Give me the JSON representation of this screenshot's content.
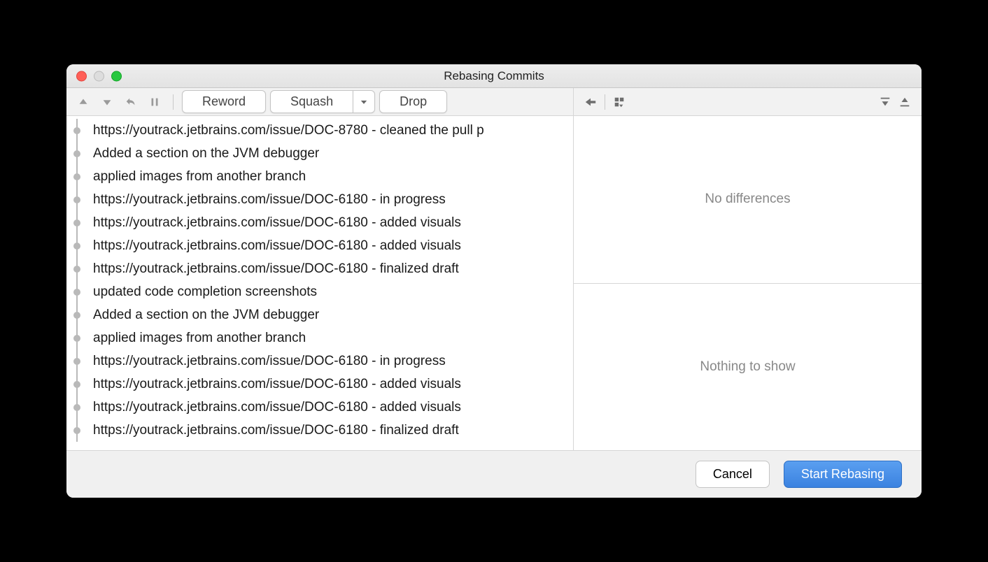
{
  "window": {
    "title": "Rebasing Commits"
  },
  "toolbar": {
    "reword": "Reword",
    "squash": "Squash",
    "drop": "Drop"
  },
  "commits": [
    {
      "msg": "https://youtrack.jetbrains.com/issue/DOC-8780 - cleaned the pull p"
    },
    {
      "msg": "Added a section on the JVM debugger"
    },
    {
      "msg": "applied images from another branch"
    },
    {
      "msg": "https://youtrack.jetbrains.com/issue/DOC-6180 - in progress"
    },
    {
      "msg": "https://youtrack.jetbrains.com/issue/DOC-6180 - added visuals"
    },
    {
      "msg": "https://youtrack.jetbrains.com/issue/DOC-6180 - added visuals"
    },
    {
      "msg": "https://youtrack.jetbrains.com/issue/DOC-6180 - finalized draft"
    },
    {
      "msg": "updated code completion screenshots"
    },
    {
      "msg": "Added a section on the JVM debugger"
    },
    {
      "msg": "applied images from another branch"
    },
    {
      "msg": "https://youtrack.jetbrains.com/issue/DOC-6180 - in progress"
    },
    {
      "msg": "https://youtrack.jetbrains.com/issue/DOC-6180 - added visuals"
    },
    {
      "msg": "https://youtrack.jetbrains.com/issue/DOC-6180 - added visuals"
    },
    {
      "msg": "https://youtrack.jetbrains.com/issue/DOC-6180 - finalized draft"
    }
  ],
  "diff": {
    "top_message": "No differences",
    "bottom_message": "Nothing to show"
  },
  "footer": {
    "cancel": "Cancel",
    "start": "Start Rebasing"
  }
}
